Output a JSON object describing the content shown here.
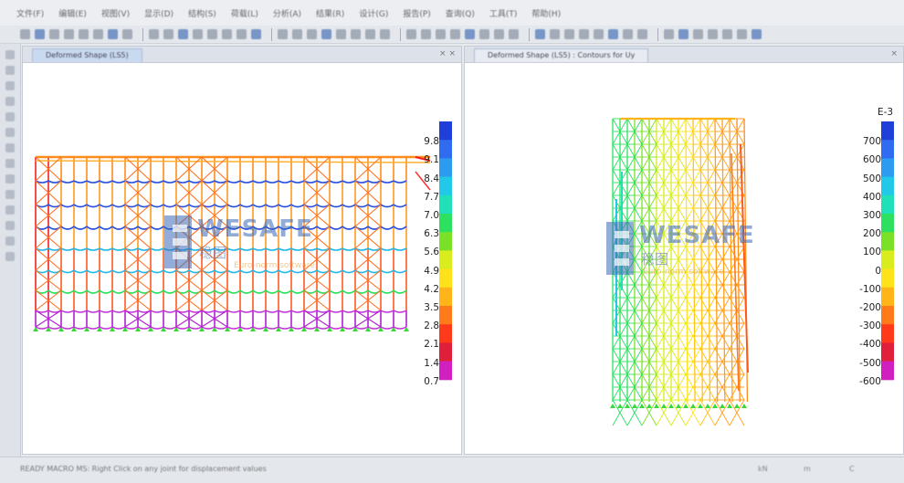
{
  "menu": [
    "文件(F)",
    "编辑(E)",
    "视图(V)",
    "显示(D)",
    "结构(S)",
    "荷载(L)",
    "分析(A)",
    "结果(R)",
    "设计(G)",
    "报告(P)",
    "查询(Q)",
    "工具(T)",
    "帮助(H)"
  ],
  "left_panel": {
    "tab": "Deformed Shape (LS5)",
    "legend_values": [
      "9.8",
      "9.1",
      "8.4",
      "7.7",
      "7.0",
      "6.3",
      "5.6",
      "4.9",
      "4.2",
      "3.5",
      "2.8",
      "2.1",
      "1.4",
      "0.7"
    ],
    "legend_colors": [
      "#1f3fd8",
      "#2f6cf0",
      "#2c9cf0",
      "#22c8e8",
      "#1fe0b8",
      "#2de060",
      "#7be028",
      "#d8ec1e",
      "#ffe21a",
      "#ffb41a",
      "#ff7a18",
      "#ff3a1a",
      "#e0203a",
      "#d020c0"
    ]
  },
  "right_panel": {
    "tab": "Deformed Shape (LS5) : Contours for Uy",
    "legend_exponent": "E-3",
    "legend_values": [
      "700",
      "600",
      "500",
      "400",
      "300",
      "200",
      "100",
      "0",
      "-100",
      "-200",
      "-300",
      "-400",
      "-500",
      "-600"
    ],
    "legend_colors": [
      "#1f3fd8",
      "#2f6cf0",
      "#2c9cf0",
      "#22c8e8",
      "#1fe0b8",
      "#2de060",
      "#7be028",
      "#d8ec1e",
      "#ffe21a",
      "#ffb41a",
      "#ff7a18",
      "#ff3a1a",
      "#e0203a",
      "#d020c0"
    ]
  },
  "watermark": {
    "brand": "WESAFE",
    "cn": "稳图",
    "tagline": "Euro-norm software"
  },
  "status": {
    "message": "READY  MACRO MS: Right Click on any joint for displacement values",
    "segments": [
      "kN",
      "m",
      "C"
    ]
  },
  "colors": {
    "frame_hot": "#ff8c1a",
    "frame_red": "#f02020",
    "frame_purple": "#b020d0",
    "frame_blue": "#2850e0",
    "support_green": "#38d838"
  }
}
